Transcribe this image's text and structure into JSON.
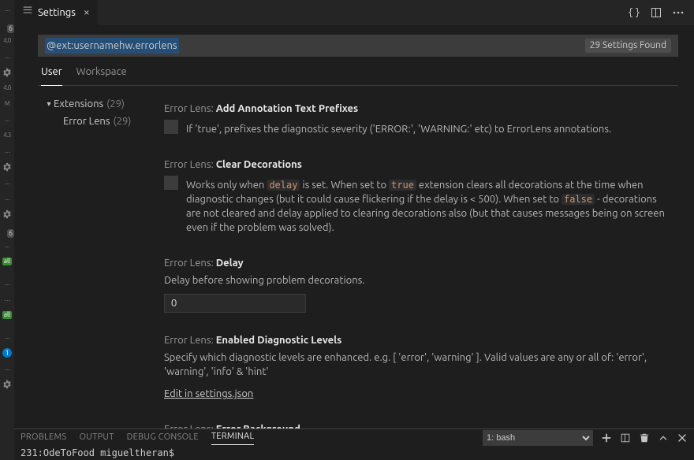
{
  "tab": {
    "title": "Settings"
  },
  "search": {
    "query": "@ext:usernamehw.errorlens",
    "count_label": "29 Settings Found"
  },
  "scope": {
    "user": "User",
    "workspace": "Workspace"
  },
  "toc": {
    "extensions_label": "Extensions",
    "extensions_count": "(29)",
    "errorlens_label": "Error Lens",
    "errorlens_count": "(29)"
  },
  "settings": [
    {
      "prefix": "Error Lens: ",
      "name": "Add Annotation Text Prefixes",
      "type": "bool",
      "desc_plain": "If 'true', prefixes the diagnostic severity ('ERROR:', 'WARNING:' etc) to ErrorLens annotations."
    },
    {
      "prefix": "Error Lens: ",
      "name": "Clear Decorations",
      "type": "bool",
      "desc_rich": {
        "p1": "Works only when ",
        "c1": "delay",
        "p2": " is set. When set to ",
        "c2": "true",
        "p3": " extension clears all decorations at the time when diagnostic changes (but it could cause flickering if the delay is < 500). When set to ",
        "c3": "false",
        "p4": " - decorations are not cleared and delay applied to clearing decorations also (but that causes messages being on screen even if the problem was solved)."
      }
    },
    {
      "prefix": "Error Lens: ",
      "name": "Delay",
      "type": "number",
      "desc_plain": "Delay before showing problem decorations.",
      "value": "0"
    },
    {
      "prefix": "Error Lens: ",
      "name": "Enabled Diagnostic Levels",
      "type": "link",
      "desc_plain": "Specify which diagnostic levels are enhanced. e.g. [ 'error', 'warning' ]. Valid values are any or all of: 'error', 'warning', 'info' & 'hint'",
      "link_label": "Edit in settings.json"
    },
    {
      "prefix": "Error Lens: ",
      "name": "Error Background",
      "type": "bool"
    }
  ],
  "panel": {
    "tabs": {
      "problems": "Problems",
      "output": "Output",
      "debug": "Debug Console",
      "terminal": "Terminal"
    },
    "term_select": "1: bash",
    "prompt": "231:OdeToFood migueltheran$"
  },
  "activity_badges": {
    "six": "6",
    "ver40": "4.0",
    "ver43": "4.3",
    "m": "M",
    "install": "all",
    "one": "1",
    "dots": "…"
  }
}
